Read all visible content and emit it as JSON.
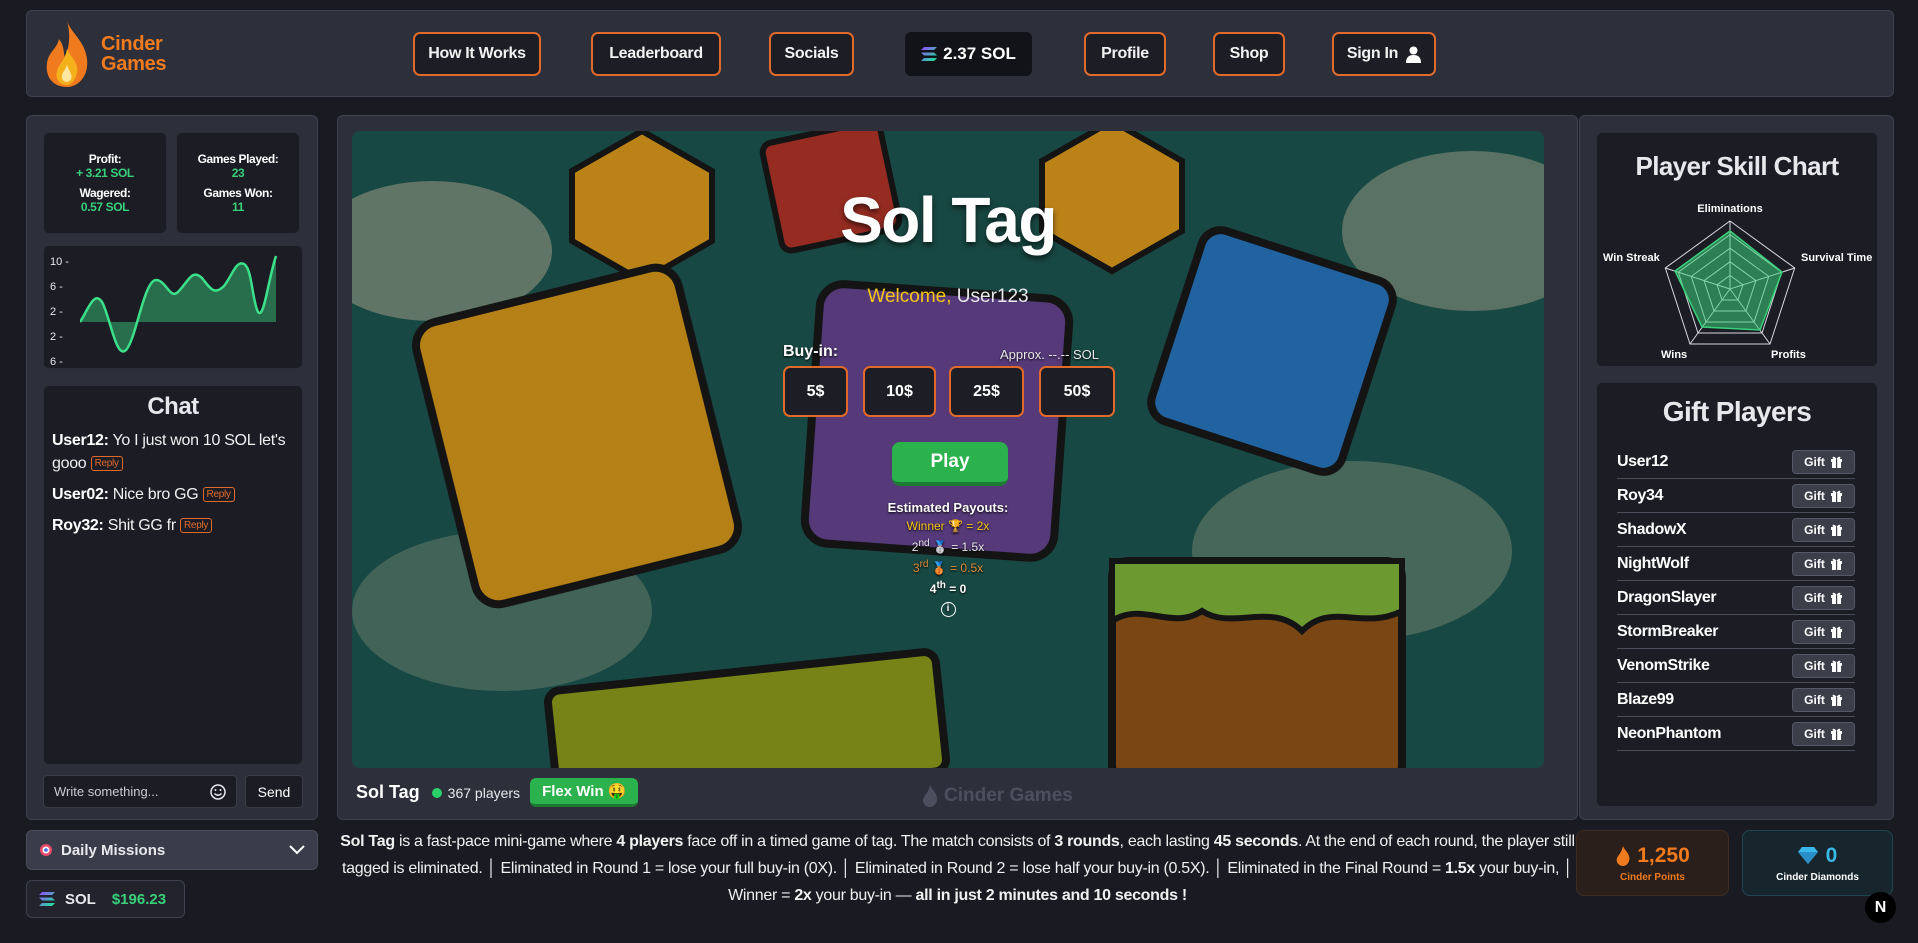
{
  "header": {
    "logo_line1": "Cinder",
    "logo_line2": "Games",
    "nav": {
      "how_it_works": "How It Works",
      "leaderboard": "Leaderboard",
      "socials": "Socials",
      "balance": "2.37 SOL",
      "profile": "Profile",
      "shop": "Shop",
      "sign_in": "Sign In"
    }
  },
  "stats": {
    "profit_label": "Profit:",
    "profit_value": "+ 3.21 SOL",
    "wagered_label": "Wagered:",
    "wagered_value": "0.57 SOL",
    "games_played_label": "Games Played:",
    "games_played_value": "23",
    "games_won_label": "Games Won:",
    "games_won_value": "11"
  },
  "mini_chart": {
    "ticks": [
      "10 -",
      "6 -",
      "2 -",
      "2 -",
      "6 -"
    ]
  },
  "chat": {
    "title": "Chat",
    "reply_label": "Reply",
    "messages": [
      {
        "user": "User12:",
        "text": "Yo I just won 10 SOL let's gooo"
      },
      {
        "user": "User02:",
        "text": "Nice bro GG"
      },
      {
        "user": "Roy32:",
        "text": "Shit GG fr"
      }
    ],
    "input_placeholder": "Write something...",
    "send_label": "Send"
  },
  "missions": {
    "label": "Daily Missions"
  },
  "wallet": {
    "currency": "SOL",
    "amount": "$196.23"
  },
  "game": {
    "title": "Sol Tag",
    "welcome_label": "Welcome,",
    "username": "User123",
    "buyin_label": "Buy-in:",
    "approx": "Approx. --.-- SOL",
    "bets": [
      "5$",
      "10$",
      "25$",
      "50$"
    ],
    "play_label": "Play",
    "payouts_title": "Estimated Payouts:",
    "payout_winner": "Winner 🏆 = 2x",
    "payout_2nd_pre": "2",
    "payout_2nd_sup": "nd",
    "payout_2nd_val": "🥈 = 1.5x",
    "payout_3rd_pre": "3",
    "payout_3rd_sup": "rd",
    "payout_3rd_val": "🥉 = 0.5x",
    "payout_4th_pre": "4",
    "payout_4th_sup": "th",
    "payout_4th_val": "= 0",
    "footer_title": "Sol Tag",
    "players": "367 players",
    "flex_win": "Flex Win 🤑",
    "watermark": "Cinder Games"
  },
  "description": {
    "t1": "Sol Tag",
    "t2": " is a fast-pace mini-game where ",
    "t3": "4 players",
    "t4": " face off in a timed game of tag. The match consists of ",
    "t5": "3 rounds",
    "t6": ", each lasting ",
    "t7": "45 seconds",
    "t8": ". At the end of each round, the player still tagged is eliminated. │ Eliminated in Round 1 = lose your full buy-in (0X). │ Eliminated in Round 2 = lose half your buy-in (0.5X). │ Eliminated in the Final Round = ",
    "t9": "1.5x",
    "t10": " your buy-in, │ Winner = ",
    "t11": "2x",
    "t12": " your buy-in — ",
    "t13": "all in just 2 minutes and 10 seconds !"
  },
  "skill_chart": {
    "title": "Player Skill Chart",
    "axes": [
      "Eliminations",
      "Survival Time",
      "Profits",
      "Wins",
      "Win Streak"
    ]
  },
  "gift": {
    "title": "Gift Players",
    "button_label": "Gift",
    "players": [
      "User12",
      "Roy34",
      "ShadowX",
      "NightWolf",
      "DragonSlayer",
      "StormBreaker",
      "VenomStrike",
      "Blaze99",
      "NeonPhantom"
    ]
  },
  "points": {
    "value": "1,250",
    "label": "Cinder Points"
  },
  "diamonds": {
    "value": "0",
    "label": "Cinder Diamonds"
  },
  "corner_badge": "N",
  "colors": {
    "accent": "#e06a2a",
    "green": "#2bb24c",
    "profit_green": "#38d07a",
    "gold": "#f5c518"
  }
}
